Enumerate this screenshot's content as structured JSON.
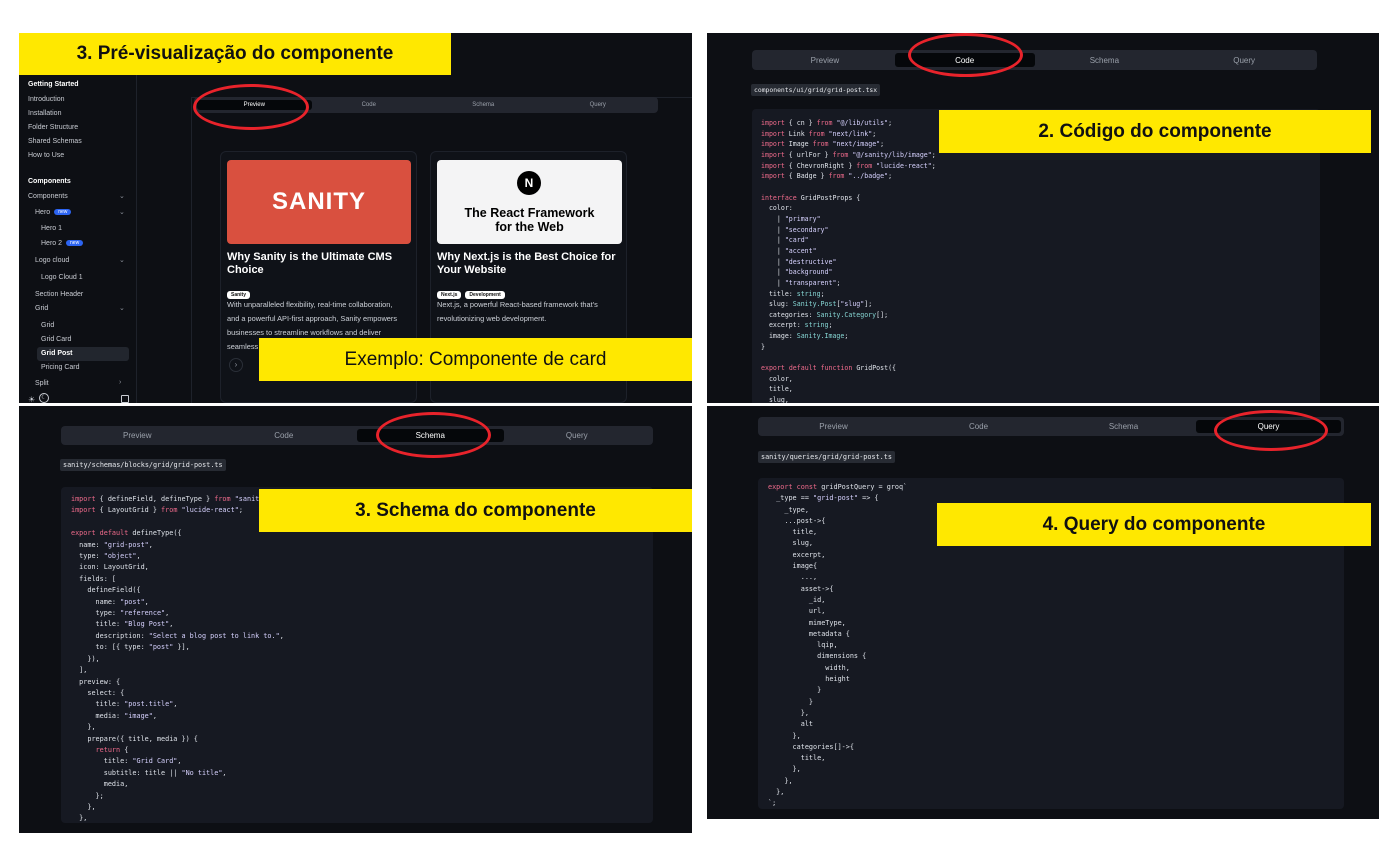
{
  "panel1": {
    "banner": "3. Pré-visualização do componente",
    "sidebar": {
      "getting_started": "Getting Started",
      "items": [
        "Introduction",
        "Installation",
        "Folder Structure",
        "Shared Schemas",
        "How to Use"
      ],
      "components_head": "Components",
      "components": "Components",
      "hero": "Hero",
      "new_badge": "new",
      "hero1": "Hero 1",
      "hero2": "Hero 2",
      "logo_cloud": "Logo cloud",
      "logo_cloud1": "Logo Cloud 1",
      "section_header": "Section Header",
      "grid": "Grid",
      "grid_items": [
        "Grid",
        "Grid Card",
        "Grid Post",
        "Pricing Card"
      ],
      "split": "Split"
    },
    "tabs": [
      "Preview",
      "Code",
      "Schema",
      "Query"
    ],
    "card1": {
      "logo": "SANITY",
      "title": "Why Sanity is the Ultimate CMS Choice",
      "chip": "Sanity",
      "text_lines": [
        "With unparalleled flexibility, real-time collaboration,",
        "and a powerful API-first approach, Sanity empowers",
        "businesses to streamline workflows and deliver",
        "seamless"
      ]
    },
    "card2": {
      "logo_letter": "N",
      "img_line1": "The React Framework",
      "img_line2": "for the Web",
      "title": "Why Next.js is the Best Choice for Your Website",
      "chips": [
        "Next.js",
        "Development"
      ],
      "text_lines": [
        "Next.js, a powerful React-based framework that's",
        "revolutionizing web development."
      ]
    },
    "example_banner": "Exemplo: Componente de card"
  },
  "panel2": {
    "tabs": [
      "Preview",
      "Code",
      "Schema",
      "Query"
    ],
    "path": "components/ui/grid/grid-post.tsx",
    "banner": "2. Código do componente",
    "code": [
      "import { cn } from \"@/lib/utils\";",
      "import Link from \"next/link\";",
      "import Image from \"next/image\";",
      "import { urlFor } from \"@/sanity/lib/image\";",
      "import { ChevronRight } from \"lucide-react\";",
      "import { Badge } from \"../badge\";",
      "",
      "interface GridPostProps {",
      "  color:",
      "    | \"primary\"",
      "    | \"secondary\"",
      "    | \"card\"",
      "    | \"accent\"",
      "    | \"destructive\"",
      "    | \"background\"",
      "    | \"transparent\";",
      "  title: string;",
      "  slug: Sanity.Post[\"slug\"];",
      "  categories: Sanity.Category[];",
      "  excerpt: string;",
      "  image: Sanity.Image;",
      "}",
      "",
      "export default function GridPost({",
      "  color,",
      "  title,",
      "  slug,"
    ]
  },
  "panel3": {
    "tabs": [
      "Preview",
      "Code",
      "Schema",
      "Query"
    ],
    "path": "sanity/schemas/blocks/grid/grid-post.ts",
    "banner": "3. Schema do componente",
    "code": [
      "import { defineField, defineType } from \"sanity",
      "import { LayoutGrid } from \"lucide-react\";",
      "",
      "export default defineType({",
      "  name: \"grid-post\",",
      "  type: \"object\",",
      "  icon: LayoutGrid,",
      "  fields: [",
      "    defineField({",
      "      name: \"post\",",
      "      type: \"reference\",",
      "      title: \"Blog Post\",",
      "      description: \"Select a blog post to link to.\",",
      "      to: [{ type: \"post\" }],",
      "    }),",
      "  ],",
      "  preview: {",
      "    select: {",
      "      title: \"post.title\",",
      "      media: \"image\",",
      "    },",
      "    prepare({ title, media }) {",
      "      return {",
      "        title: \"Grid Card\",",
      "        subtitle: title || \"No title\",",
      "        media,",
      "      };",
      "    },",
      "  },"
    ]
  },
  "panel4": {
    "tabs": [
      "Preview",
      "Code",
      "Schema",
      "Query"
    ],
    "path": "sanity/queries/grid/grid-post.ts",
    "banner": "4. Query do componente",
    "code": [
      "export const gridPostQuery = groq`",
      "  _type == \"grid-post\" => {",
      "    _type,",
      "    ...post->{",
      "      title,",
      "      slug,",
      "      excerpt,",
      "      image{",
      "        ...,",
      "        asset->{",
      "          _id,",
      "          url,",
      "          mimeType,",
      "          metadata {",
      "            lqip,",
      "            dimensions {",
      "              width,",
      "              height",
      "            }",
      "          }",
      "        },",
      "        alt",
      "      },",
      "      categories[]->{",
      "        title,",
      "      },",
      "    },",
      "  },",
      "`;"
    ]
  },
  "colors": {
    "banner": "#ffe800",
    "ring": "#e8232b",
    "panel": "#0d0f14",
    "sanity_red": "#d9503f"
  }
}
